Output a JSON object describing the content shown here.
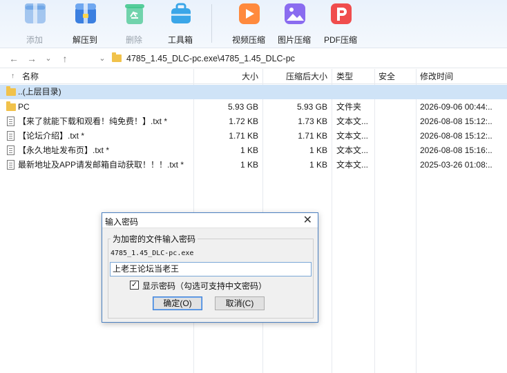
{
  "toolbar": {
    "buttons": [
      {
        "label": "添加",
        "disabled": true,
        "color": "#4a8fe0"
      },
      {
        "label": "解压到",
        "disabled": false,
        "color": "#3b7fe0"
      },
      {
        "label": "删除",
        "disabled": true,
        "color": "#3cc58a"
      },
      {
        "label": "工具箱",
        "disabled": false,
        "color": "#3aa6e8"
      },
      {
        "label": "视频压缩",
        "disabled": false,
        "color": "#ff8a3d"
      },
      {
        "label": "图片压缩",
        "disabled": false,
        "color": "#8a6cf0"
      },
      {
        "label": "PDF压缩",
        "disabled": false,
        "color": "#f04d4d"
      }
    ]
  },
  "address": {
    "path": "4785_1.45_DLC-pc.exe\\4785_1.45_DLC-pc",
    "nav_icons": [
      "back-arrow-icon",
      "forward-arrow-icon",
      "chevron-down-icon",
      "up-arrow-icon",
      "chevron-down-icon"
    ]
  },
  "columns": {
    "name": "名称",
    "size": "大小",
    "packed": "压缩后大小",
    "type": "类型",
    "security": "安全",
    "modified": "修改时间"
  },
  "rows": [
    {
      "icon": "folder",
      "name": "..(上层目录)",
      "size": "",
      "packed": "",
      "type": "",
      "modified": "",
      "selected": true
    },
    {
      "icon": "folder",
      "name": "PC",
      "size": "5.93 GB",
      "packed": "5.93 GB",
      "type": "文件夹",
      "modified": "2026-09-06 00:44:..",
      "selected": false
    },
    {
      "icon": "doc",
      "name": "【来了就能下载和观看！纯免费！】.txt *",
      "size": "1.72 KB",
      "packed": "1.73 KB",
      "type": "文本文...",
      "modified": "2026-08-08 15:12:..",
      "selected": false
    },
    {
      "icon": "doc",
      "name": "【论坛介绍】.txt *",
      "size": "1.71 KB",
      "packed": "1.71 KB",
      "type": "文本文...",
      "modified": "2026-08-08 15:12:..",
      "selected": false
    },
    {
      "icon": "doc",
      "name": "【永久地址发布页】.txt *",
      "size": "1 KB",
      "packed": "1 KB",
      "type": "文本文...",
      "modified": "2026-08-08 15:16:..",
      "selected": false
    },
    {
      "icon": "doc",
      "name": "最新地址及APP请发邮箱自动获取！！！.txt *",
      "size": "1 KB",
      "packed": "1 KB",
      "type": "文本文...",
      "modified": "2025-03-26 01:08:..",
      "selected": false
    }
  ],
  "dialog": {
    "title": "输入密码",
    "group_label": "为加密的文件输入密码",
    "file_name": "4785_1.45_DLC-pc.exe",
    "password_value": "上老王论坛当老王",
    "show_password_checked": true,
    "show_password_label": "显示密码（勾选可支持中文密码）",
    "ok_label": "确定(O)",
    "cancel_label": "取消(C)"
  }
}
